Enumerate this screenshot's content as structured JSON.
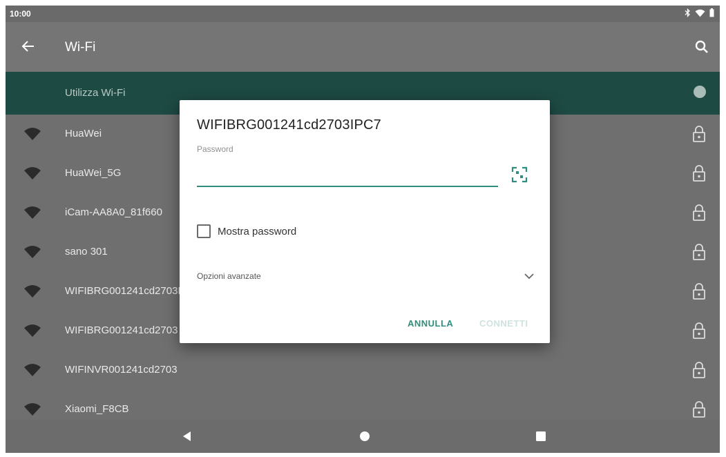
{
  "status_bar": {
    "time": "10:00",
    "icons": [
      "bluetooth-icon",
      "wifi-icon",
      "battery-icon"
    ]
  },
  "app_bar": {
    "title": "Wi-Fi",
    "back_icon": "arrow-left-icon",
    "search_icon": "search-icon"
  },
  "wifi_toggle": {
    "label": "Utilizza Wi-Fi",
    "on": true
  },
  "networks": [
    {
      "name": "HuaWei",
      "locked": true
    },
    {
      "name": "HuaWei_5G",
      "locked": true
    },
    {
      "name": "iCam-AA8A0_81f660",
      "locked": true
    },
    {
      "name": "sano 301",
      "locked": true
    },
    {
      "name": "WIFIBRG001241cd2703IPC7",
      "locked": true
    },
    {
      "name": "WIFIBRG001241cd2703",
      "locked": true
    },
    {
      "name": "WIFINVR001241cd2703",
      "locked": true
    },
    {
      "name": "Xiaomi_F8CB",
      "locked": true
    }
  ],
  "dialog": {
    "title": "WIFIBRG001241cd2703IPC7",
    "password_label": "Password",
    "password_value": "",
    "show_password_label": "Mostra password",
    "show_password_checked": false,
    "advanced_label": "Opzioni avanzate",
    "cancel_label": "ANNULLA",
    "connect_label": "CONNETTI",
    "connect_enabled": false
  },
  "colors": {
    "accent": "#2f8e7d",
    "toggle_bar": "#1e4a44",
    "scrim": "#6f6f6f"
  },
  "nav_bar": {
    "icons": [
      "back-triangle-icon",
      "home-circle-icon",
      "recents-square-icon"
    ]
  }
}
